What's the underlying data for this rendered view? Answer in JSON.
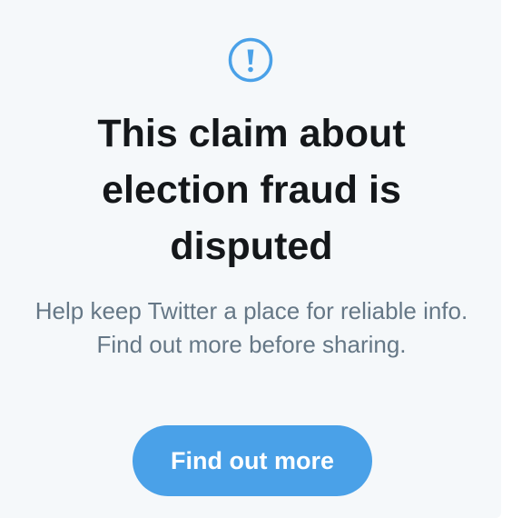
{
  "notice": {
    "icon": "alert-circle-icon",
    "headline": "This claim about election fraud is disputed",
    "body": "Help keep Twitter a place for reliable info. Find out more before sharing.",
    "button_label": "Find out more"
  },
  "colors": {
    "accent": "#4aa1e8",
    "headline": "#14171a",
    "body": "#657786",
    "background": "#f5f8fa"
  }
}
